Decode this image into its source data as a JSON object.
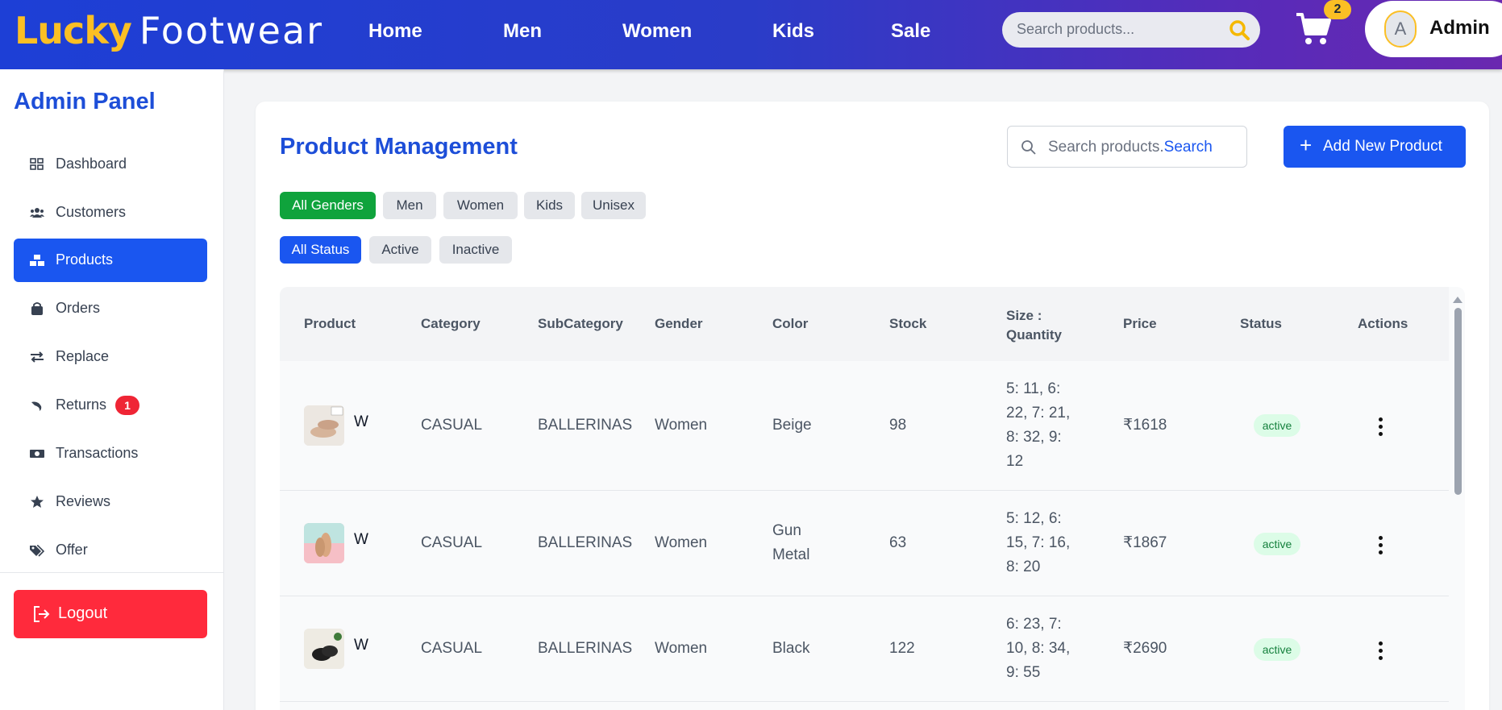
{
  "header": {
    "brand_lucky": "Lucky",
    "brand_footwear": "Footwear",
    "nav": [
      "Home",
      "Men",
      "Women",
      "Kids",
      "Sale"
    ],
    "search_placeholder": "Search products...",
    "cart_count": "2",
    "avatar_initial": "A",
    "user_name": "Admin",
    "colors": {
      "accent": "#fbbf24",
      "gradient_start": "#1d3fd6",
      "gradient_end": "#6a28b0"
    }
  },
  "sidebar": {
    "title": "Admin Panel",
    "items": [
      {
        "label": "Dashboard",
        "icon": "grid-icon"
      },
      {
        "label": "Customers",
        "icon": "users-icon"
      },
      {
        "label": "Products",
        "icon": "boxes-icon",
        "active": true
      },
      {
        "label": "Orders",
        "icon": "bag-icon"
      },
      {
        "label": "Replace",
        "icon": "exchange-icon"
      },
      {
        "label": "Returns",
        "icon": "return-icon",
        "badge": "1"
      },
      {
        "label": "Transactions",
        "icon": "money-icon"
      },
      {
        "label": "Reviews",
        "icon": "star-icon"
      },
      {
        "label": "Offer",
        "icon": "tags-icon"
      }
    ],
    "logout_label": "Logout"
  },
  "main": {
    "title": "Product Management",
    "search_text": "Search products.",
    "search_button": "Search",
    "add_button": "Add New Product",
    "gender_filters": [
      "All Genders",
      "Men",
      "Women",
      "Kids",
      "Unisex"
    ],
    "status_filters": [
      "All Status",
      "Active",
      "Inactive"
    ],
    "table": {
      "headers": [
        "Product",
        "Category",
        "SubCategory",
        "Gender",
        "Color",
        "Stock",
        "Size : Quantity",
        "Price",
        "Status",
        "Actions"
      ],
      "rows": [
        {
          "name": "W",
          "category": "CASUAL",
          "subcategory": "BALLERINAS",
          "gender": "Women",
          "color": "Beige",
          "stock": "98",
          "sizes": "5: 11, 6: 22, 7: 21, 8: 32, 9: 12",
          "price": "₹1618",
          "status": "active"
        },
        {
          "name": "W",
          "category": "CASUAL",
          "subcategory": "BALLERINAS",
          "gender": "Women",
          "color": "Gun Metal",
          "stock": "63",
          "sizes": "5: 12, 6: 15, 7: 16, 8: 20",
          "price": "₹1867",
          "status": "active"
        },
        {
          "name": "W",
          "category": "CASUAL",
          "subcategory": "BALLERINAS",
          "gender": "Women",
          "color": "Black",
          "stock": "122",
          "sizes": "6: 23, 7: 10, 8: 34, 9: 55",
          "price": "₹2690",
          "status": "active"
        }
      ]
    }
  }
}
